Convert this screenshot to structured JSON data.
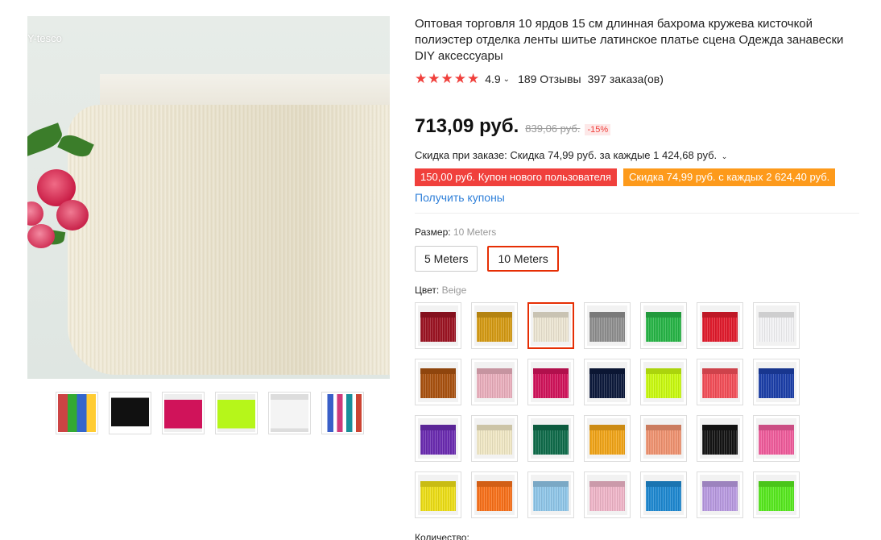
{
  "gallery": {
    "watermark": "Y-tesco",
    "thumbnails": [
      {
        "name": "assorted-colors",
        "color": "#c44"
      },
      {
        "name": "black-skirt",
        "color": "#111"
      },
      {
        "name": "rose-fringe",
        "color": "#d0135a"
      },
      {
        "name": "neon-fringe",
        "color": "#b6f61a"
      },
      {
        "name": "white-fringe",
        "color": "#f4f4f4"
      },
      {
        "name": "dancers",
        "color": "#3a5fc8"
      }
    ]
  },
  "product": {
    "title": "Оптовая торговля 10 ярдов 15 см длинная бахрома кружева кисточкой полиэстер отделка ленты шитье латинское платье сцена Одежда занавески DIY аксессуары",
    "stars": "★★★★★",
    "rating": "4.9",
    "reviews": "189 Отзывы",
    "orders": "397 заказа(ов)",
    "price": "713,09 руб.",
    "old_price": "839,06 руб.",
    "discount": "-15%",
    "order_discount": "Скидка при заказе: Скидка 74,99 руб. за каждые 1 424,68 руб.",
    "coupon_new_user": "150,00 руб. Купон нового пользователя",
    "coupon_discount": "Скидка 74,99 руб. с каждых 2 624,40 руб.",
    "get_coupons": "Получить купоны",
    "size_label": "Размер:",
    "size_value": "10 Meters",
    "sizes": [
      "5 Meters",
      "10 Meters"
    ],
    "color_label": "Цвет:",
    "color_value": "Beige",
    "quantity_label": "Количество:"
  },
  "swatches": [
    "#9b1322",
    "#d49a14",
    "#ece5d2",
    "#8f8f8f",
    "#27b446",
    "#e01b2c",
    "#f2f2f4",
    "#a8510f",
    "#e9aebc",
    "#d0135a",
    "#0d1a3c",
    "#c9f90f",
    "#f24e58",
    "#1c3fa8",
    "#6a2bb0",
    "#f0e7c4",
    "#0f6b4a",
    "#f0a418",
    "#ef9270",
    "#141414",
    "#ef5c9b",
    "#ecdd16",
    "#f7701a",
    "#8fc6e8",
    "#efb5c8",
    "#1e88d0",
    "#b89ae0",
    "#57e81e"
  ],
  "colors": {
    "accent": "#e62e04",
    "star": "#f0403c",
    "link": "#2e7fd9",
    "coupon_red": "#f0403c",
    "coupon_orange": "#fd9a1b"
  }
}
